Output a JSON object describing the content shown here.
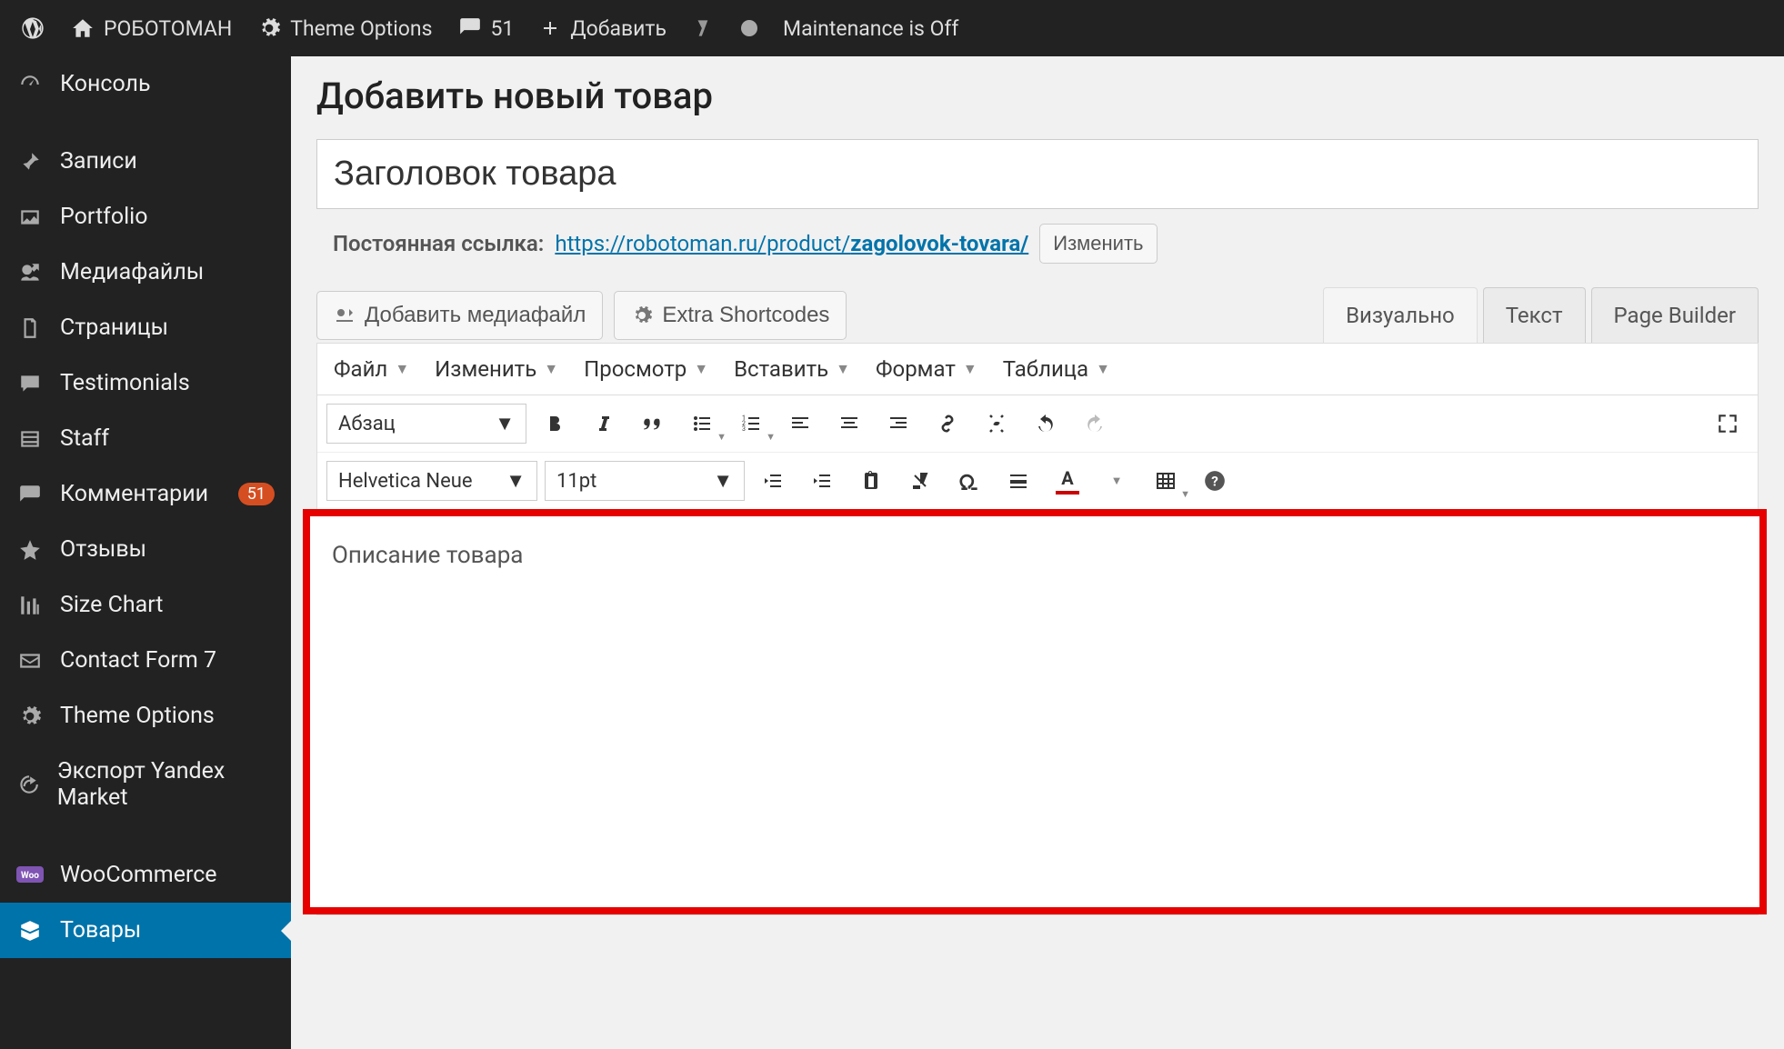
{
  "adminBar": {
    "siteName": "РОБОТОМАН",
    "themeOptions": "Theme Options",
    "commentsCount": "51",
    "addNew": "Добавить",
    "maintenance": "Maintenance is Off"
  },
  "sidebar": {
    "items": [
      {
        "label": "Консоль",
        "icon": "dashboard"
      },
      {
        "label": "Записи",
        "icon": "pin"
      },
      {
        "label": "Portfolio",
        "icon": "gallery"
      },
      {
        "label": "Медиафайлы",
        "icon": "media"
      },
      {
        "label": "Страницы",
        "icon": "page"
      },
      {
        "label": "Testimonials",
        "icon": "testimonial"
      },
      {
        "label": "Staff",
        "icon": "staff"
      },
      {
        "label": "Комментарии",
        "icon": "comment",
        "badge": "51"
      },
      {
        "label": "Отзывы",
        "icon": "star"
      },
      {
        "label": "Size Chart",
        "icon": "chart"
      },
      {
        "label": "Contact Form 7",
        "icon": "envelope"
      },
      {
        "label": "Theme Options",
        "icon": "cog"
      },
      {
        "label": "Экспорт Yandex Market",
        "icon": "export"
      },
      {
        "label": "WooCommerce",
        "icon": "woo"
      },
      {
        "label": "Товары",
        "icon": "products",
        "active": true
      }
    ]
  },
  "main": {
    "pageTitle": "Добавить новый товар",
    "titleValue": "Заголовок товара",
    "permalink": {
      "label": "Постоянная ссылка:",
      "base": "https://robotoman.ru/product/",
      "slug": "zagolovok-tovara/",
      "editBtn": "Изменить"
    },
    "editor": {
      "addMediaBtn": "Добавить медиафайл",
      "extraShortcodesBtn": "Extra Shortcodes",
      "tabs": {
        "visual": "Визуально",
        "text": "Текст",
        "pageBuilder": "Page Builder"
      },
      "menuBar": [
        "Файл",
        "Изменить",
        "Просмотр",
        "Вставить",
        "Формат",
        "Таблица"
      ],
      "formatSelect": "Абзац",
      "fontSelect": "Helvetica Neue",
      "sizeSelect": "11pt",
      "content": "Описание товара"
    }
  },
  "icons": {
    "bullist_caret": "▾",
    "numlist_caret": "▾"
  }
}
